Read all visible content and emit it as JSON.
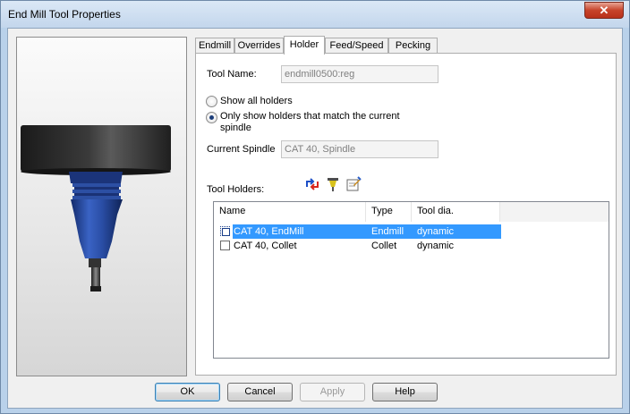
{
  "window": {
    "title": "End Mill Tool Properties",
    "close_glyph": "✕"
  },
  "tabs": [
    "Endmill",
    "Overrides",
    "Holder",
    "Feed/Speed",
    "Pecking"
  ],
  "active_tab": "Holder",
  "holder": {
    "tool_name_label": "Tool Name:",
    "tool_name_value": "endmill0500:reg",
    "radio_show_all": "Show all holders",
    "radio_match_line1": "Only show holders that match the current",
    "radio_match_line2": "spindle",
    "selected_radio": "match",
    "current_spindle_label": "Current Spindle",
    "current_spindle_value": "CAT 40, Spindle",
    "tool_holders_label": "Tool Holders:",
    "toolbar_icons": [
      "swap-holder-icon",
      "tool-holder-icon",
      "edit-holder-icon"
    ],
    "columns": [
      "Name",
      "Type",
      "Tool dia."
    ],
    "rows": [
      {
        "name": "CAT 40, EndMill",
        "type": "Endmill",
        "tool_dia": "dynamic",
        "checked": true,
        "selected": true
      },
      {
        "name": "CAT 40, Collet",
        "type": "Collet",
        "tool_dia": "dynamic",
        "checked": false,
        "selected": false
      }
    ]
  },
  "buttons": {
    "ok": "OK",
    "cancel": "Cancel",
    "apply": "Apply",
    "help": "Help"
  },
  "colors": {
    "selection": "#3399ff",
    "holder_body": "#1e3f8f",
    "flange": "#2a2a2a"
  }
}
